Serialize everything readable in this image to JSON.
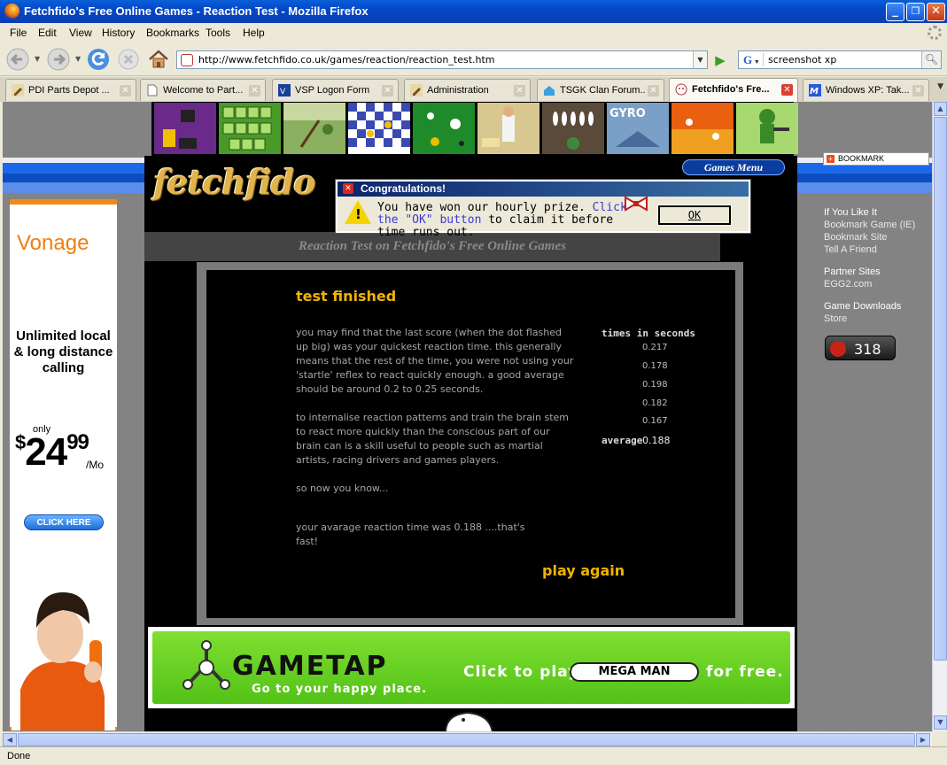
{
  "window": {
    "title": "Fetchfido's Free Online Games - Reaction Test - Mozilla Firefox",
    "buttons": {
      "minimize": "_",
      "maximize": "❐",
      "close": "✕"
    }
  },
  "menu": [
    "File",
    "Edit",
    "View",
    "History",
    "Bookmarks",
    "Tools",
    "Help"
  ],
  "navigation": {
    "url": "http://www.fetchfido.co.uk/games/reaction/reaction_test.htm",
    "search_engine": "G",
    "search_query": "screenshot xp"
  },
  "tabs": [
    {
      "label": "PDI Parts Depot ...",
      "active": false
    },
    {
      "label": "Welcome to Part...",
      "active": false
    },
    {
      "label": "VSP Logon Form",
      "active": false
    },
    {
      "label": "Administration",
      "active": false
    },
    {
      "label": "TSGK Clan Forum...",
      "active": false
    },
    {
      "label": "Fetchfido's Fre...",
      "active": true
    },
    {
      "label": "Windows XP: Tak...",
      "active": false
    }
  ],
  "site": {
    "logo": "fetchfido",
    "games_menu": "Games Menu",
    "page_heading": "Reaction Test on Fetchfido's Free Online Games"
  },
  "popup": {
    "title": "Congratulations!",
    "message_plain": "You have won our hourly prize.",
    "message_link1": "Click the",
    "message_link2": "\"OK\" button",
    "message_tail": "to claim it before time runs out.",
    "ok_label": "OK"
  },
  "game": {
    "title": "test finished",
    "paragraph1": "you may find that the last score (when the dot flashed up big) was your quickest reaction time. this generally means that the rest of the time, you were not using your 'startle' reflex to react quickly enough. a good average should be around 0.2 to 0.25 seconds.",
    "paragraph2": "to internalise reaction patterns and train the brain stem to react more quickly than the conscious part of our brain can is a skill useful to people such as martial artists, racing drivers and games players.",
    "paragraph3": "so now you know...",
    "paragraph4": "your avarage reaction time was 0.188 ....that's fast!",
    "times_heading": "times in seconds",
    "times": [
      "0.217",
      "0.178",
      "0.198",
      "0.182",
      "0.167"
    ],
    "average_label": "average",
    "average_value": "0.188",
    "play_again": "play again"
  },
  "left_ad": {
    "brand": "Vonage",
    "headline": "Unlimited local & long distance calling",
    "only": "only",
    "price_symbol": "$",
    "price_main": "24",
    "price_cents": "99",
    "price_unit": "/Mo",
    "cta": "CLICK HERE"
  },
  "sidebar": {
    "bookmark_button": "BOOKMARK",
    "if_you_like_it": "If You Like It",
    "bookmark_game": "Bookmark Game (IE)",
    "bookmark_site": "Bookmark Site",
    "tell_friend": "Tell A Friend",
    "partner_sites": "Partner Sites",
    "egg2": "EGG2.com",
    "game_downloads": "Game Downloads",
    "store": "Store",
    "counter": "318"
  },
  "gametap_ad": {
    "logo": "GAMETAP",
    "tagline": "Go to your happy place.",
    "click_to_play": "Click to play",
    "game": "MEGA MAN",
    "for_free": "for free."
  },
  "status": "Done",
  "colors": {
    "accent_gold": "#f0b400",
    "site_blue": "#1b68e8",
    "page_gray": "#838383",
    "gametap_green": "#6cd424",
    "vonage_orange": "#f07d12"
  }
}
